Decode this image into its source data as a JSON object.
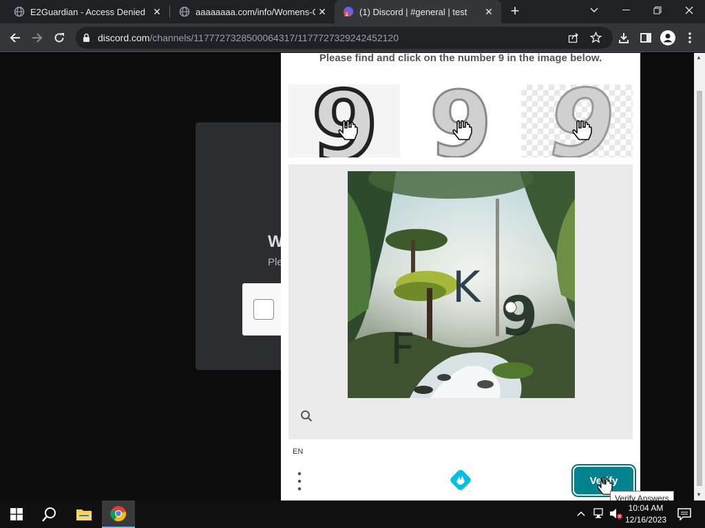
{
  "browser": {
    "tabs": [
      {
        "title": "E2Guardian - Access Denied",
        "icon": "globe-icon"
      },
      {
        "title": "aaaaaaaa.com/info/Womens-Clo",
        "icon": "globe-icon"
      },
      {
        "title": "(1) Discord | #general | test",
        "icon": "discord-icon",
        "badge": "1"
      }
    ],
    "url_host": "discord.com",
    "url_path": "/channels/1177727328500064317/1177727329242452120"
  },
  "discord": {
    "heading": "W",
    "subtext": "Ple"
  },
  "captcha": {
    "prompt": "Please find and click on the number 9 in the image below.",
    "example_glyph": "9",
    "scene_letters": [
      "K",
      "9",
      "F"
    ],
    "language": "EN",
    "verify_label": "Verify",
    "tooltip": "Verify Answers",
    "accent_color": "#00838f"
  },
  "taskbar": {
    "time": "10:04 AM",
    "date": "12/16/2023"
  }
}
